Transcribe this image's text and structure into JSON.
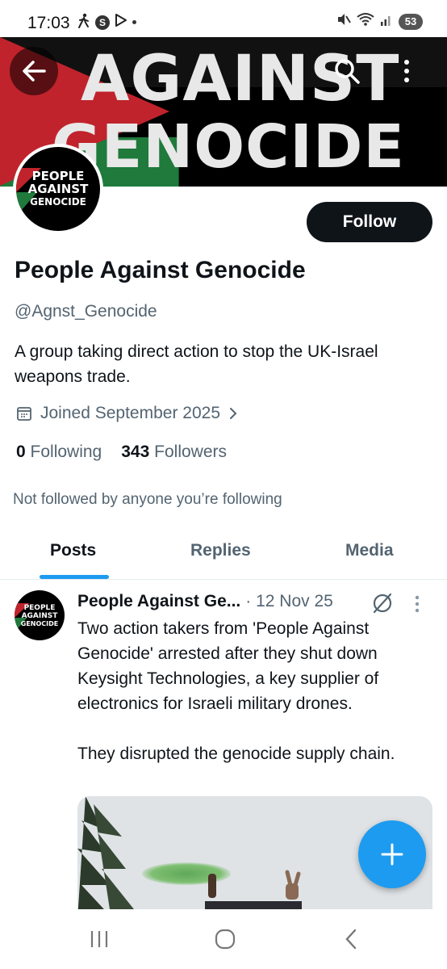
{
  "status_bar": {
    "time": "17:03",
    "icons_left": [
      "walking-icon",
      "s-app-icon",
      "play-icon",
      "dot-icon"
    ],
    "s_app_letter": "S",
    "icons_right": [
      "mute-icon",
      "wifi-icon",
      "signal-icon"
    ],
    "battery": "53"
  },
  "banner": {
    "line1": "AGAINST",
    "line2": "GENOCIDE",
    "colors": {
      "red": "#c0232b",
      "green": "#1f7a3c",
      "black": "#000000"
    }
  },
  "header": {
    "back_icon": "arrow-left-icon",
    "search_icon": "search-icon",
    "more_icon": "more-vertical-icon"
  },
  "profile": {
    "avatar_text": [
      "PEOPLE",
      "AGAINST",
      "GENOCIDE"
    ],
    "follow_label": "Follow",
    "display_name": "People Against Genocide",
    "handle": "@Agnst_Genocide",
    "bio": "A group taking direct action to stop the UK-Israel weapons trade.",
    "joined": "Joined September 2025",
    "following_count": "0",
    "following_label": "Following",
    "followers_count": "343",
    "followers_label": "Followers",
    "not_followed": "Not followed by anyone you’re following"
  },
  "tabs": [
    {
      "label": "Posts",
      "active": true
    },
    {
      "label": "Replies",
      "active": false
    },
    {
      "label": "Media",
      "active": false
    }
  ],
  "post": {
    "avatar_text": [
      "PEOPLE",
      "AGAINST",
      "GENOCIDE"
    ],
    "name": "People Against Ge...",
    "meta": "· 12 Nov 25",
    "text": "Two action takers from 'People Against Genocide' arrested after they shut down Keysight Technologies, a key supplier of electronics for Israeli military drones.\n\nThey disrupted the genocide supply chain."
  },
  "fab": {
    "icon": "plus-icon",
    "color": "#1d9bf0"
  },
  "navbar": {
    "icons": [
      "recent-apps-icon",
      "home-icon",
      "back-icon"
    ]
  },
  "accent": "#1d9bf0"
}
